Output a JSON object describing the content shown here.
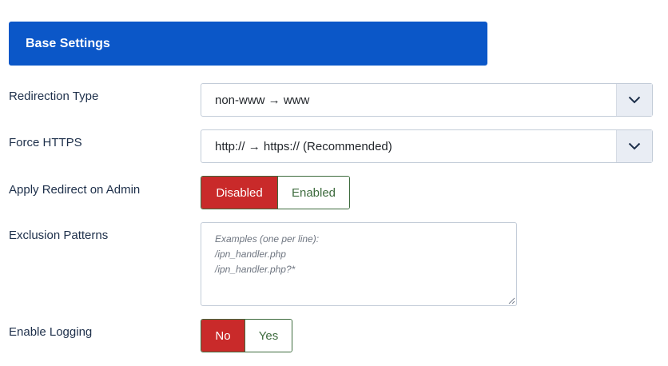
{
  "section": {
    "title": "Base Settings"
  },
  "fields": {
    "redirection_type": {
      "label": "Redirection Type",
      "value": "non-www → www",
      "icon": "chevron-down-icon"
    },
    "force_https": {
      "label": "Force HTTPS",
      "value": "http:// → https:// (Recommended)",
      "icon": "chevron-down-icon"
    },
    "apply_redirect_admin": {
      "label": "Apply Redirect on Admin",
      "options": [
        "Disabled",
        "Enabled"
      ],
      "selected": "Disabled"
    },
    "exclusion_patterns": {
      "label": "Exclusion Patterns",
      "placeholder": "Examples (one per line):\n/ipn_handler.php\n/ipn_handler.php?*"
    },
    "enable_logging": {
      "label": "Enable Logging",
      "options": [
        "No",
        "Yes"
      ],
      "selected": "No"
    }
  },
  "colors": {
    "header_bg": "#0b57c8",
    "active_toggle": "#c92a2a",
    "inactive_toggle_text": "#3d6b3d"
  }
}
